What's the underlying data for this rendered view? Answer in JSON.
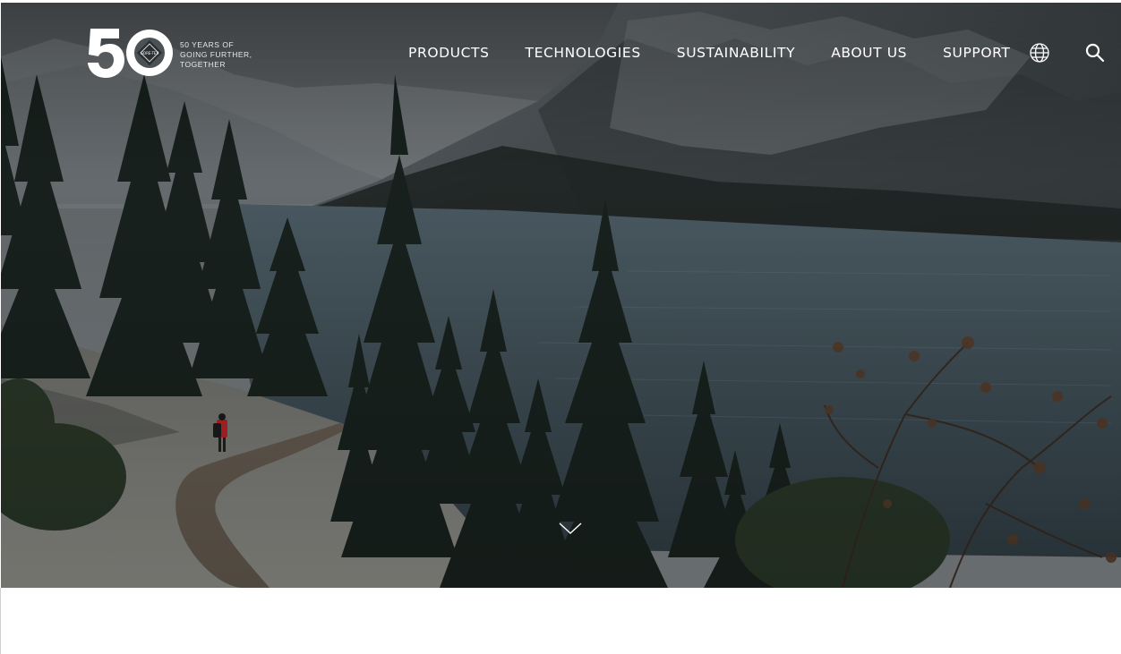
{
  "brand": {
    "logo_number": "50",
    "logo_badge": "GORE-TEX",
    "tagline_lines": [
      "50 Years of",
      "Going Further,",
      "Together"
    ]
  },
  "nav": {
    "items": [
      {
        "label": "PRODUCTS"
      },
      {
        "label": "TECHNOLOGIES"
      },
      {
        "label": "SUSTAINABILITY"
      },
      {
        "label": "ABOUT US"
      },
      {
        "label": "SUPPORT"
      }
    ]
  },
  "icons": {
    "language": "globe-icon",
    "search": "search-icon",
    "scroll": "chevron-down-icon"
  },
  "colors": {
    "nav_text": "#ffffff",
    "page_bg": "#ffffff",
    "lake": "#42515a"
  }
}
